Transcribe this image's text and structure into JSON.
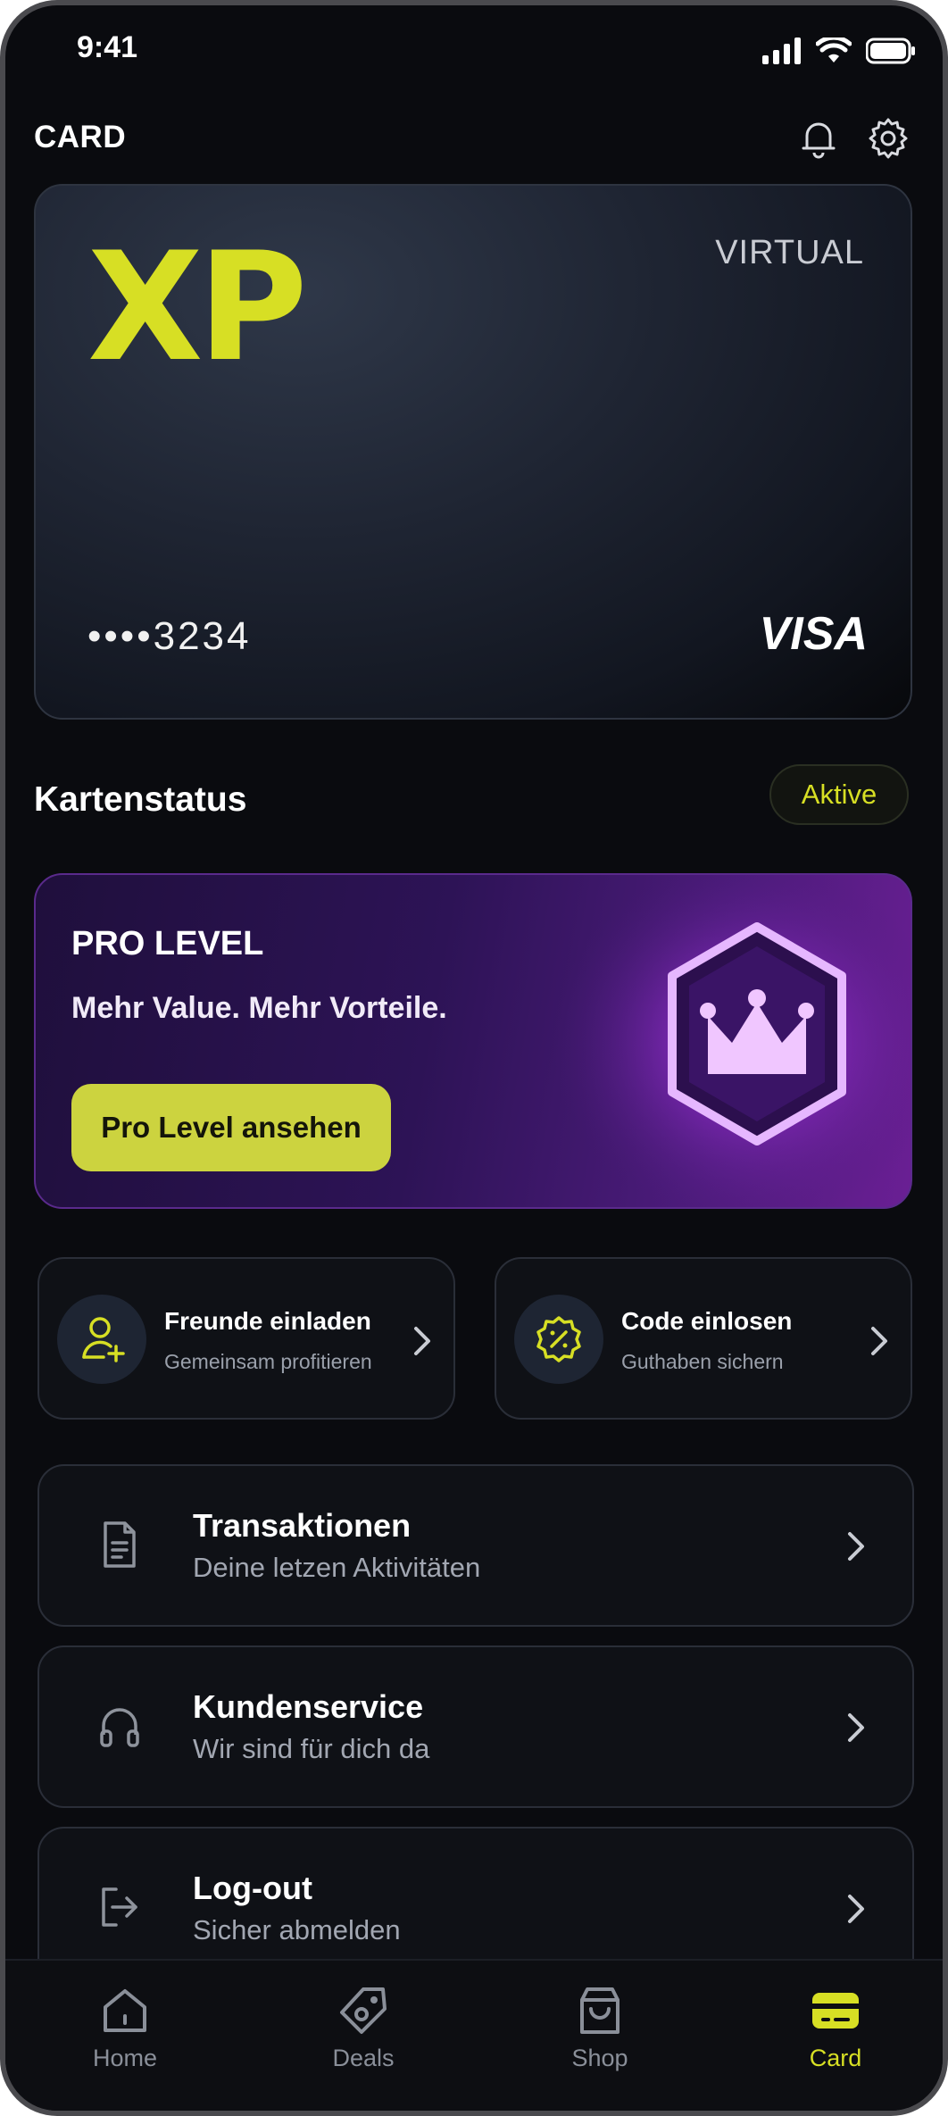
{
  "status_bar": {
    "time": "9:41"
  },
  "header": {
    "title": "CARD"
  },
  "card": {
    "brand_logo": "XP",
    "type": "VIRTUAL",
    "number_masked": "••••3234",
    "network": "VISA"
  },
  "card_status": {
    "title": "Kartenstatus",
    "badge": "Aktive"
  },
  "pro_level": {
    "title": "PRO LEVEL",
    "subtitle": "Mehr Value. Mehr Vorteile.",
    "button_label": "Pro Level ansehen"
  },
  "quick_tiles": [
    {
      "title": "Freunde einladen",
      "subtitle": "Gemeinsam profitieren",
      "icon": "user-plus-icon"
    },
    {
      "title": "Code einlosen",
      "subtitle": "Guthaben sichern",
      "icon": "discount-badge-icon"
    }
  ],
  "menu_rows": [
    {
      "title": "Transaktionen",
      "subtitle": "Deine letzen Aktivitäten",
      "icon": "document-icon"
    },
    {
      "title": "Kundenservice",
      "subtitle": "Wir sind für dich da",
      "icon": "headphones-icon"
    },
    {
      "title": "Log-out",
      "subtitle": "Sicher abmelden",
      "icon": "logout-icon"
    }
  ],
  "tab_bar": {
    "items": [
      {
        "label": "Home",
        "icon": "home-icon"
      },
      {
        "label": "Deals",
        "icon": "tag-icon"
      },
      {
        "label": "Shop",
        "icon": "shopping-bag-icon"
      },
      {
        "label": "Card",
        "icon": "credit-card-icon"
      }
    ],
    "active": "Card"
  },
  "colors": {
    "accent": "#d7df24",
    "background": "#0a0b0f",
    "pro_purple": "#6a1f94"
  }
}
